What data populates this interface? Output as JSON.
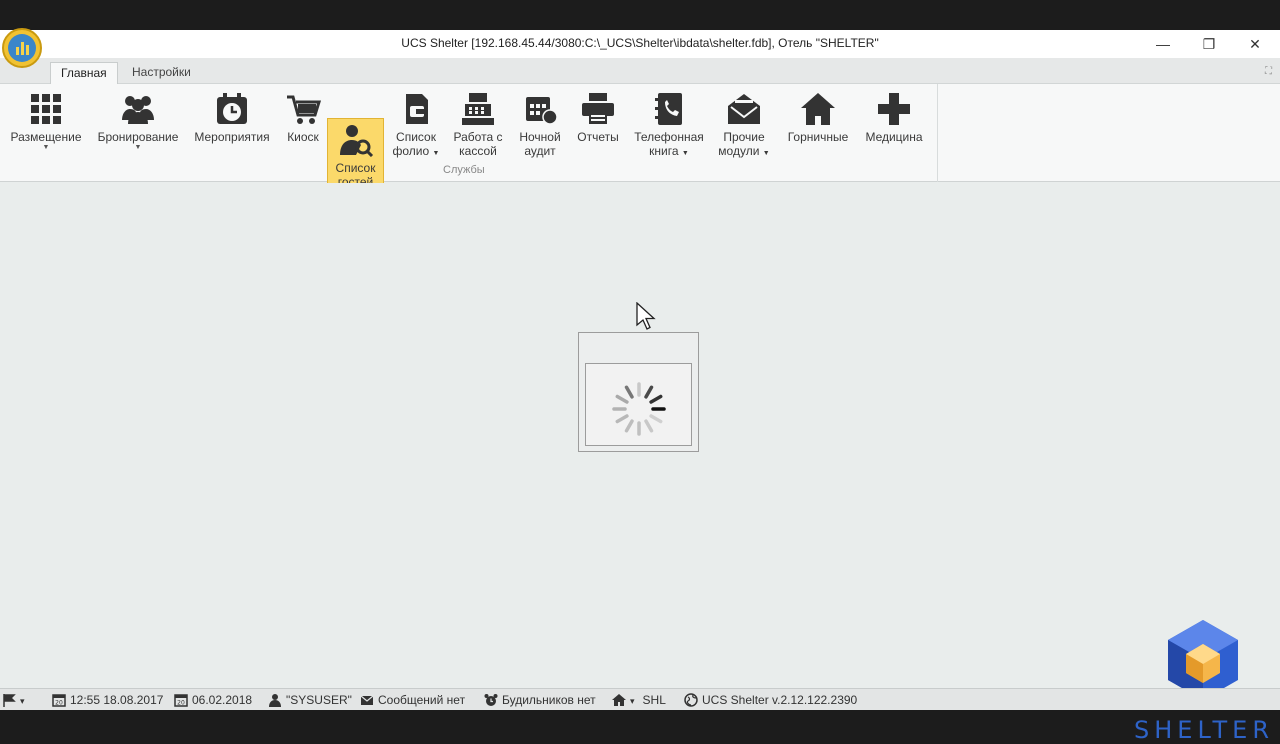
{
  "window": {
    "title": "UCS Shelter [192.168.45.44/3080:C:\\_UCS\\Shelter\\ibdata\\shelter.fdb], Отель \"SHELTER\"",
    "minimize_glyph": "—",
    "maximize_glyph": "❐",
    "close_glyph": "✕"
  },
  "tabs": [
    {
      "label": "Главная",
      "active": true
    },
    {
      "label": "Настройки",
      "active": false
    }
  ],
  "ribbon": {
    "group_label": "Службы",
    "buttons": [
      {
        "line1": "Размещение",
        "line2": "",
        "dropdown": true,
        "icon": "grid-icon"
      },
      {
        "line1": "Бронирование",
        "line2": "",
        "dropdown": true,
        "icon": "people-icon"
      },
      {
        "line1": "Мероприятия",
        "line2": "",
        "dropdown": false,
        "icon": "calendar-clock-icon"
      },
      {
        "line1": "Киоск",
        "line2": "",
        "dropdown": false,
        "icon": "cart-icon"
      },
      {
        "line1": "Список",
        "line2": "гостей",
        "dropdown": false,
        "icon": "guest-search-icon",
        "active": true
      },
      {
        "line1": "Список",
        "line2": "фолио",
        "dropdown": true,
        "icon": "folio-icon"
      },
      {
        "line1": "Работа с",
        "line2": "кассой",
        "dropdown": false,
        "icon": "cash-register-icon"
      },
      {
        "line1": "Ночной",
        "line2": "аудит",
        "dropdown": false,
        "icon": "night-audit-icon"
      },
      {
        "line1": "Отчеты",
        "line2": "",
        "dropdown": false,
        "icon": "printer-icon"
      },
      {
        "line1": "Телефонная",
        "line2": "книга",
        "dropdown": true,
        "icon": "phonebook-icon"
      },
      {
        "line1": "Прочие",
        "line2": "модули",
        "dropdown": true,
        "icon": "envelope-icon"
      },
      {
        "line1": "Горничные",
        "line2": "",
        "dropdown": false,
        "icon": "house-icon"
      },
      {
        "line1": "Медицина",
        "line2": "",
        "dropdown": false,
        "icon": "medical-cross-icon"
      }
    ],
    "collapse_glyph": "⛶"
  },
  "statusbar": {
    "flag_arrow": "▾",
    "login_time": "12:55 18.08.2017",
    "work_date": "06.02.2018",
    "user": "\"SYSUSER\"",
    "messages": "Сообщений нет",
    "alarms": "Будильников нет",
    "home_arrow": "▾",
    "hotel_code": "SHL",
    "version": "UCS Shelter v.2.12.122.2390"
  },
  "brand": {
    "wordmark": "SHELTER",
    "color": "#2e63c8"
  },
  "colors": {
    "active_button": "#fbd96a",
    "background": "#e9edec"
  }
}
